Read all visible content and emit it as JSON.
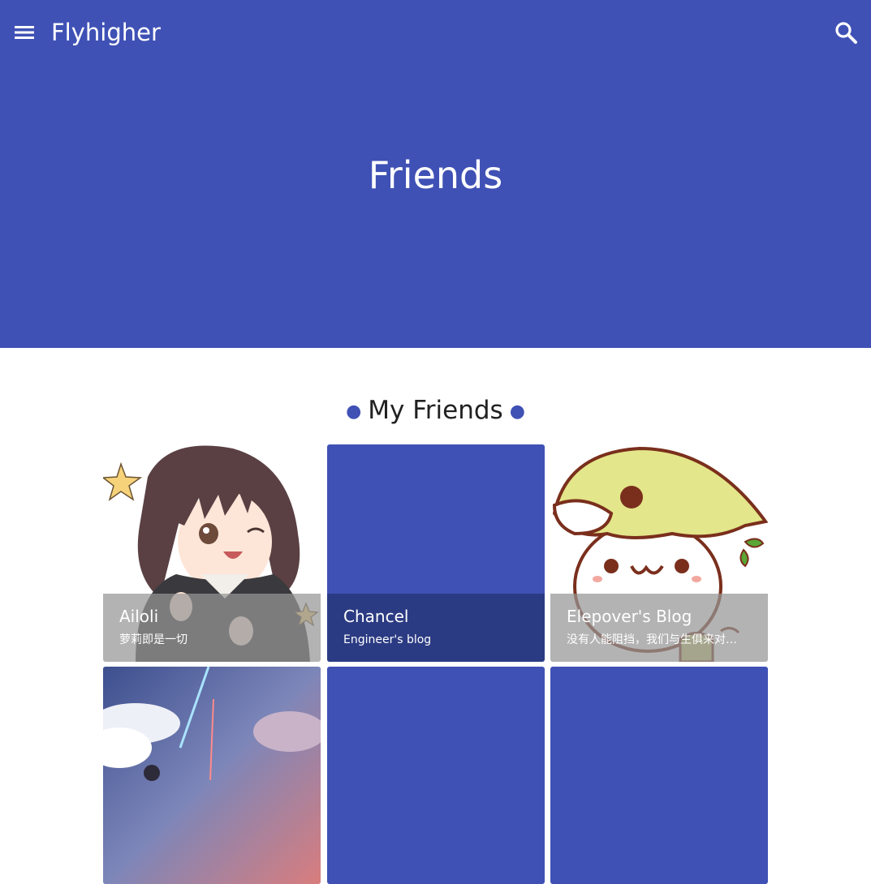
{
  "header": {
    "site_title": "Flyhigher",
    "page_title": "Friends",
    "brand_color": "#3f51b5",
    "menu_icon": "menu-icon",
    "search_icon": "search-icon"
  },
  "section": {
    "title": "My Friends"
  },
  "friends": [
    {
      "name": "Ailoli",
      "desc": "萝莉即是一切",
      "image": "anime-girl-avatar"
    },
    {
      "name": "Chancel",
      "desc": "Engineer's blog",
      "image": ""
    },
    {
      "name": "Elepover's Blog",
      "desc": "没有人能阻挡，我们与生俱来对…",
      "image": "cartoon-cat-avatar"
    },
    {
      "name": "",
      "desc": "",
      "image": "anime-sky-scene"
    },
    {
      "name": "",
      "desc": "",
      "image": ""
    },
    {
      "name": "",
      "desc": "",
      "image": ""
    }
  ]
}
